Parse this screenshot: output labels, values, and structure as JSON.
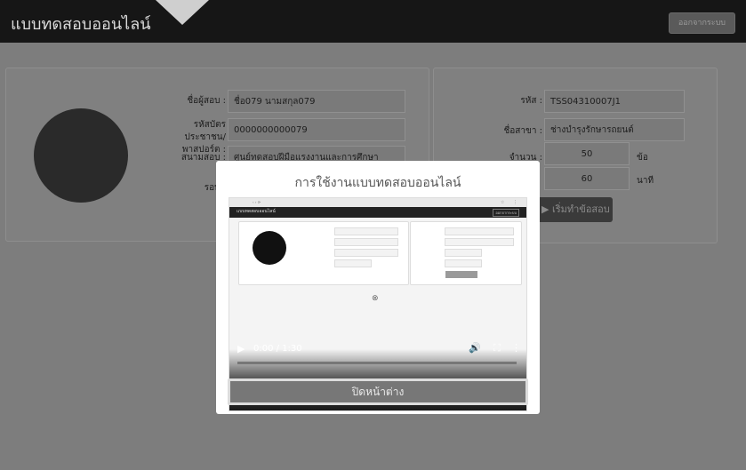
{
  "header": {
    "brand": "แบบทดสอบออนไลน์",
    "logout_label": "ออกจากระบบ"
  },
  "profile": {
    "name_label": "ชื่อผู้สอบ :",
    "name_value": "ชื่อ079 นามสกุล079",
    "id_label": "รหัสบัตรประชาชน/พาสปอร์ต :",
    "id_value": "0000000000079",
    "site_label": "สนามสอบ :",
    "site_value": "ศูนย์ทดสอบฝีมือแรงงานและการศึกษา",
    "round_label": "รอบ :"
  },
  "exam": {
    "code_label": "รหัส :",
    "code_value": "TSS04310007J1",
    "branch_label": "ชื่อสาขา :",
    "branch_value": "ช่างบำรุงรักษารถยนต์",
    "count_label": "จำนวน :",
    "count_value": "50",
    "count_unit": "ข้อ",
    "time_value": "60",
    "time_unit": "นาที",
    "start_label": "▶ เริ่มทำข้อสอบ"
  },
  "modal": {
    "title": "การใช้งานแบบทดสอบออนไลน์",
    "video": {
      "time_text": "0:00 / 1:30",
      "progress": 0.0
    },
    "close_label": "ปิดหน้าต่าง"
  }
}
